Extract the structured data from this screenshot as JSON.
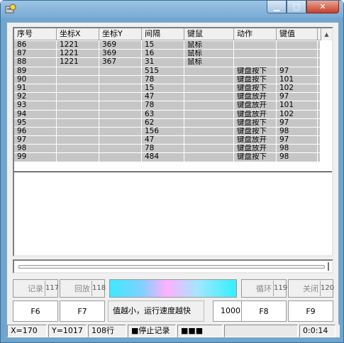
{
  "window": {
    "title": ""
  },
  "columns": [
    "序号",
    "坐标X",
    "坐标Y",
    "间隔",
    "键鼠",
    "动作",
    "键值"
  ],
  "rows": [
    [
      "86",
      "1221",
      "369",
      "15",
      "鼠标",
      "",
      ""
    ],
    [
      "87",
      "1221",
      "369",
      "16",
      "鼠标",
      "",
      ""
    ],
    [
      "88",
      "1221",
      "367",
      "31",
      "鼠标",
      "",
      ""
    ],
    [
      "89",
      "",
      "",
      "515",
      "",
      "键盘按下",
      "97"
    ],
    [
      "90",
      "",
      "",
      "78",
      "",
      "键盘按下",
      "101"
    ],
    [
      "91",
      "",
      "",
      "15",
      "",
      "键盘按下",
      "102"
    ],
    [
      "92",
      "",
      "",
      "47",
      "",
      "键盘放开",
      "97"
    ],
    [
      "93",
      "",
      "",
      "78",
      "",
      "键盘放开",
      "101"
    ],
    [
      "94",
      "",
      "",
      "63",
      "",
      "键盘放开",
      "102"
    ],
    [
      "95",
      "",
      "",
      "62",
      "",
      "键盘按下",
      "97"
    ],
    [
      "96",
      "",
      "",
      "156",
      "",
      "键盘按下",
      "98"
    ],
    [
      "97",
      "",
      "",
      "47",
      "",
      "键盘放开",
      "97"
    ],
    [
      "98",
      "",
      "",
      "78",
      "",
      "键盘放开",
      "98"
    ],
    [
      "99",
      "",
      "",
      "484",
      "",
      "键盘按下",
      "98"
    ]
  ],
  "controls": {
    "record": {
      "label": "记录",
      "code": "117",
      "key": "F6"
    },
    "playback": {
      "label": "回放",
      "code": "118",
      "key": "F7"
    },
    "loop": {
      "label": "循环",
      "code": "119",
      "key": "F8"
    },
    "close": {
      "label": "关闭",
      "code": "120",
      "key": "F9"
    },
    "speed_hint": "值越小，运行速度越快",
    "speed_value": "1000"
  },
  "status": {
    "x": "X=170",
    "y": "Y=1017",
    "rows": "108行",
    "state": "■停止记录",
    "indicator": "■■■",
    "dim_text": "",
    "time": "0:0:14"
  },
  "colors": {
    "row_bg": "#c6c6c6",
    "title_bg": "#7aaad4"
  }
}
